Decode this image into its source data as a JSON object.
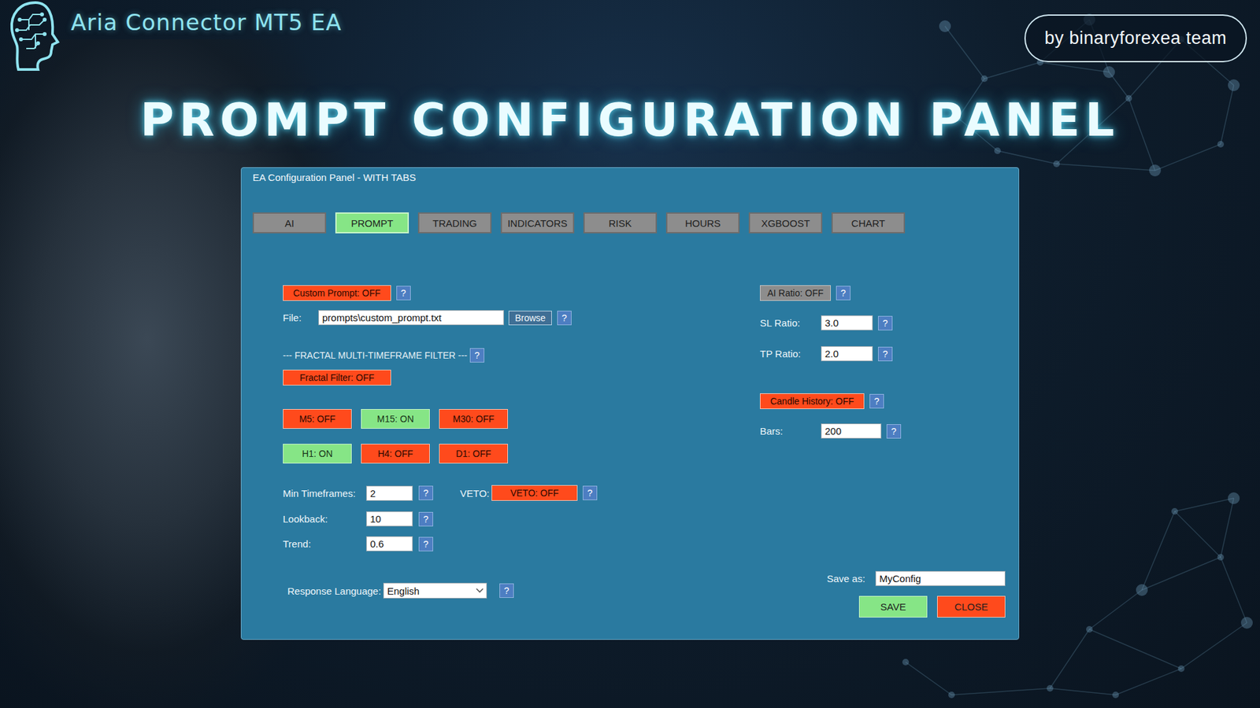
{
  "header": {
    "title": "Aria Connector MT5 EA",
    "badge": "by binaryforexea team",
    "headline": "PROMPT CONFIGURATION PANEL"
  },
  "window": {
    "title": "EA Configuration Panel - WITH TABS"
  },
  "tabs": [
    {
      "label": "AI",
      "selected": false
    },
    {
      "label": "PROMPT",
      "selected": true
    },
    {
      "label": "TRADING",
      "selected": false
    },
    {
      "label": "INDICATORS",
      "selected": false
    },
    {
      "label": "RISK",
      "selected": false
    },
    {
      "label": "HOURS",
      "selected": false
    },
    {
      "label": "XGBOOST",
      "selected": false
    },
    {
      "label": "CHART",
      "selected": false
    }
  ],
  "custom_prompt": {
    "label": "Custom Prompt: OFF",
    "on": false,
    "disabled": false,
    "help": "?"
  },
  "file": {
    "label": "File:",
    "value": "prompts\\custom_prompt.txt",
    "button": "Browse",
    "help": "?"
  },
  "fractal": {
    "section": "--- FRACTAL MULTI-TIMEFRAME FILTER ---",
    "section_help": "?",
    "toggle": {
      "label": "Fractal Filter: OFF",
      "on": false,
      "disabled": false
    },
    "timeframes": [
      {
        "label": "M5: OFF",
        "on": false
      },
      {
        "label": "M15: ON",
        "on": true
      },
      {
        "label": "M30: OFF",
        "on": false
      },
      {
        "label": "H1: ON",
        "on": true
      },
      {
        "label": "H4: OFF",
        "on": false
      },
      {
        "label": "D1: OFF",
        "on": false
      }
    ],
    "min_timeframes": {
      "label": "Min Timeframes:",
      "value": "2",
      "help": "?"
    },
    "veto": {
      "label": "VETO:",
      "button": "VETO: OFF",
      "on": false,
      "help": "?"
    },
    "lookback": {
      "label": "Lookback:",
      "value": "10",
      "help": "?"
    },
    "trend": {
      "label": "Trend:",
      "value": "0.6",
      "help": "?"
    }
  },
  "response_language": {
    "label": "Response Language:",
    "value": "English",
    "help": "?"
  },
  "ai_ratio": {
    "label": "AI Ratio: OFF",
    "on": false,
    "disabled": true,
    "help": "?"
  },
  "sl_ratio": {
    "label": "SL Ratio:",
    "value": "3.0",
    "help": "?"
  },
  "tp_ratio": {
    "label": "TP Ratio:",
    "value": "2.0",
    "help": "?"
  },
  "candle_history": {
    "label": "Candle History: OFF",
    "on": false,
    "disabled": false,
    "help": "?"
  },
  "bars": {
    "label": "Bars:",
    "value": "200",
    "help": "?"
  },
  "save": {
    "label": "Save as:",
    "value": "MyConfig"
  },
  "buttons": [
    {
      "label": "SAVE",
      "kind": "save"
    },
    {
      "label": "CLOSE",
      "kind": "close"
    }
  ]
}
